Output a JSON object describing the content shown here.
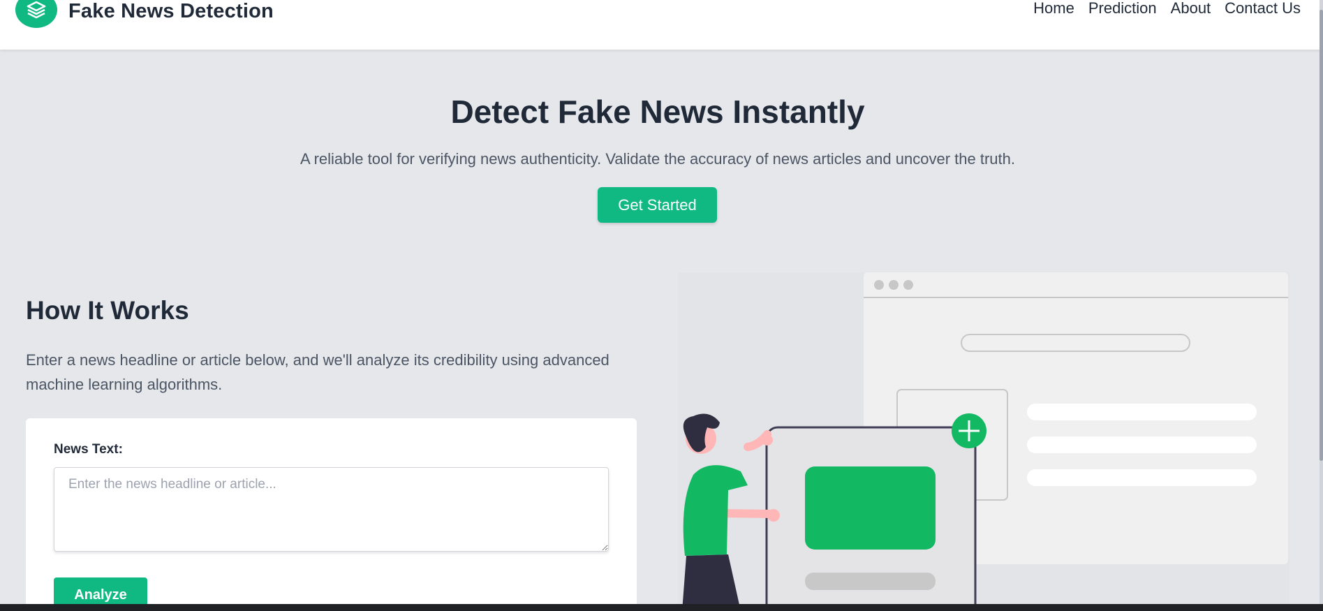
{
  "header": {
    "brand_name": "Fake News Detection",
    "logo_icon": "stacked-layers-icon",
    "nav": [
      "Home",
      "Prediction",
      "About",
      "Contact Us"
    ]
  },
  "hero": {
    "title": "Detect Fake News Instantly",
    "subtitle": "A reliable tool for verifying news authenticity. Validate the accuracy of news articles and uncover the truth.",
    "cta_label": "Get Started"
  },
  "how_it_works": {
    "title": "How It Works",
    "description": "Enter a news headline or article below, and we'll analyze its credibility using advanced machine learning algorithms.",
    "form": {
      "label": "News Text:",
      "placeholder": "Enter the news headline or article...",
      "value": "",
      "submit_label": "Analyze"
    }
  },
  "theme": {
    "accent": "#10b981",
    "background": "#e5e7eb",
    "text": "#1f2937"
  }
}
